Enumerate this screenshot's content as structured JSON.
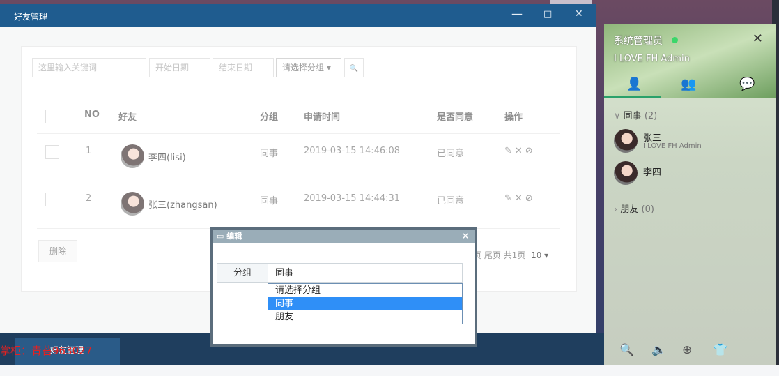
{
  "window": {
    "title": "好友管理",
    "controls": {
      "minimize": "—",
      "maximize": "□",
      "close": "✕"
    }
  },
  "search": {
    "keyword_placeholder": "这里输入关键词",
    "start_date_placeholder": "开始日期",
    "end_date_placeholder": "结束日期",
    "group_select_label": "请选择分组 ▾",
    "search_icon": "🔍"
  },
  "table": {
    "headers": {
      "no": "NO",
      "friend": "好友",
      "group": "分组",
      "time": "申请时间",
      "agree": "是否同意",
      "action": "操作"
    },
    "rows": [
      {
        "no": "1",
        "friend": "李四(lisi)",
        "group": "同事",
        "time": "2019-03-15 14:46:08",
        "agree": "已同意",
        "ops": "✎✕⊘"
      },
      {
        "no": "2",
        "friend": "张三(zhangsan)",
        "group": "同事",
        "time": "2019-03-15 14:44:31",
        "agree": "已同意",
        "ops": "✎✕⊘"
      }
    ]
  },
  "delete_label": "删除",
  "pager": {
    "text": "页 尾页 共1页",
    "size": "10 ▾"
  },
  "dialog": {
    "title": "▭ 编辑",
    "close": "×",
    "field_label": "分组",
    "field_value": "同事",
    "options": [
      "请选择分组",
      "同事",
      "朋友"
    ],
    "selected_index": 1
  },
  "taskbar": {
    "item_label": "好友管理",
    "shop_text": "掌柜：青苔963027"
  },
  "chat": {
    "user_name": "系统管理员",
    "signature": "I LOVE FH Admin",
    "close": "✕",
    "tabs_icons": [
      "👤",
      "👥",
      "💬"
    ],
    "groups": [
      {
        "name": "同事",
        "count": "(2)",
        "arrow": "∨"
      },
      {
        "name": "朋友",
        "count": "(0)",
        "arrow": "›"
      }
    ],
    "friends": [
      {
        "name": "张三",
        "sign": "I LOVE FH Admin"
      },
      {
        "name": "李四",
        "sign": ""
      }
    ],
    "bottom_icons": [
      "🔍",
      "🔈",
      "⊕",
      "👕"
    ]
  },
  "colors": {
    "titlebar": "#1f5c8f",
    "selected_option": "#2f8ff7",
    "shop_text": "#e8201f"
  }
}
